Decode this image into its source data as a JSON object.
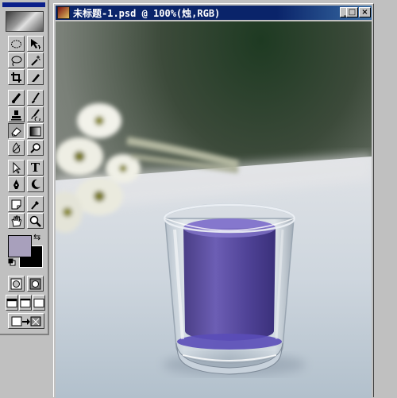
{
  "toolbox": {
    "tools": [
      {
        "name": "marquee-tool-icon"
      },
      {
        "name": "move-tool-icon"
      },
      {
        "name": "lasso-tool-icon"
      },
      {
        "name": "magic-wand-tool-icon"
      },
      {
        "name": "crop-tool-icon"
      },
      {
        "name": "slice-tool-icon"
      },
      {
        "name": "healing-brush-tool-icon"
      },
      {
        "name": "brush-tool-icon"
      },
      {
        "name": "clone-stamp-tool-icon"
      },
      {
        "name": "history-brush-tool-icon"
      },
      {
        "name": "eraser-tool-icon"
      },
      {
        "name": "gradient-tool-icon"
      },
      {
        "name": "blur-tool-icon"
      },
      {
        "name": "dodge-tool-icon"
      },
      {
        "name": "path-selection-tool-icon"
      },
      {
        "name": "type-tool-icon"
      },
      {
        "name": "pen-tool-icon"
      },
      {
        "name": "custom-shape-tool-icon"
      },
      {
        "name": "notes-tool-icon"
      },
      {
        "name": "eyedropper-tool-icon"
      },
      {
        "name": "hand-tool-icon"
      },
      {
        "name": "zoom-tool-icon"
      }
    ],
    "type_tool_glyph": "T",
    "foreground_color": "#a8a0bc",
    "background_color": "#000000"
  },
  "document": {
    "title": "未标题-1.psd @ 100%(烛,RGB)",
    "minimize_glyph": "_",
    "maximize_glyph": "□",
    "close_glyph": "×"
  }
}
